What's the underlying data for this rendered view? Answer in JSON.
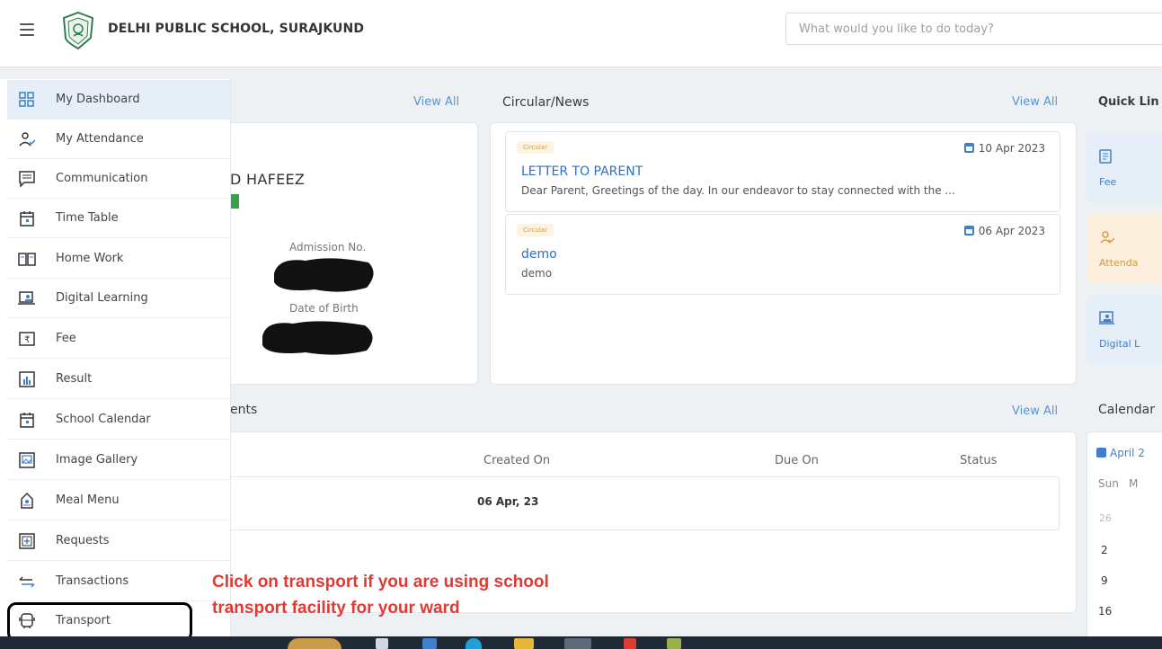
{
  "header": {
    "school_name": "DELHI PUBLIC SCHOOL, SURAJKUND",
    "search_placeholder": "What would you like to do today?"
  },
  "profile": {
    "view_all": "View All",
    "student_name": "D HAFEEZ",
    "admission_label": "Admission No.",
    "dob_label": "Date of Birth"
  },
  "news": {
    "title": "Circular/News",
    "view_all": "View All",
    "items": [
      {
        "tag": "Circular",
        "date": "10 Apr 2023",
        "title": "LETTER TO PARENT",
        "desc": "Dear Parent, Greetings of the day. In our endeavor to stay connected with the ..."
      },
      {
        "tag": "Circular",
        "date": "06 Apr 2023",
        "title": "demo",
        "desc": "demo"
      }
    ]
  },
  "quick_links": {
    "title": "Quick Lin",
    "items": [
      {
        "label": "Fee",
        "icon": "fee-icon",
        "color": "#e6eef7"
      },
      {
        "label": "Attenda",
        "icon": "attendance-icon",
        "color": "#fbeedd"
      },
      {
        "label": "Digital L",
        "icon": "digital-learning-icon",
        "color": "#e6eef7"
      }
    ]
  },
  "assignments": {
    "title": "ents",
    "view_all": "View All",
    "columns": [
      "Created On",
      "Due On",
      "Status"
    ],
    "rows": [
      {
        "created_on": "06 Apr, 23",
        "due_on": "",
        "status": ""
      }
    ]
  },
  "calendar": {
    "title": "Calendar",
    "month": "April 2",
    "weekday_header": [
      "Sun",
      "M"
    ],
    "days": [
      "26",
      "2",
      "9",
      "16"
    ]
  },
  "sidebar": {
    "items": [
      {
        "label": "My Dashboard",
        "icon": "dashboard-grid-icon"
      },
      {
        "label": "My Attendance",
        "icon": "attendance-icon"
      },
      {
        "label": "Communication",
        "icon": "chat-icon"
      },
      {
        "label": "Time Table",
        "icon": "calendar-icon"
      },
      {
        "label": "Home Work",
        "icon": "book-icon"
      },
      {
        "label": "Digital Learning",
        "icon": "digital-learning-icon"
      },
      {
        "label": "Fee",
        "icon": "rupee-icon"
      },
      {
        "label": "Result",
        "icon": "bar-chart-icon"
      },
      {
        "label": "School Calendar",
        "icon": "calendar-icon"
      },
      {
        "label": "Image Gallery",
        "icon": "image-icon"
      },
      {
        "label": "Meal Menu",
        "icon": "meal-icon"
      },
      {
        "label": "Requests",
        "icon": "plus-box-icon"
      },
      {
        "label": "Transactions",
        "icon": "transfer-arrows-icon"
      },
      {
        "label": "Transport",
        "icon": "bus-icon"
      }
    ]
  },
  "annotation": {
    "line1": "Click on transport if you are using school",
    "line2": "transport facility for your ward",
    "color": "#e03a34"
  },
  "colors": {
    "accent": "#3f7fcc",
    "link": "#2f6fc7",
    "active_item": "#e6eef7",
    "tag": "#d59a3a"
  }
}
